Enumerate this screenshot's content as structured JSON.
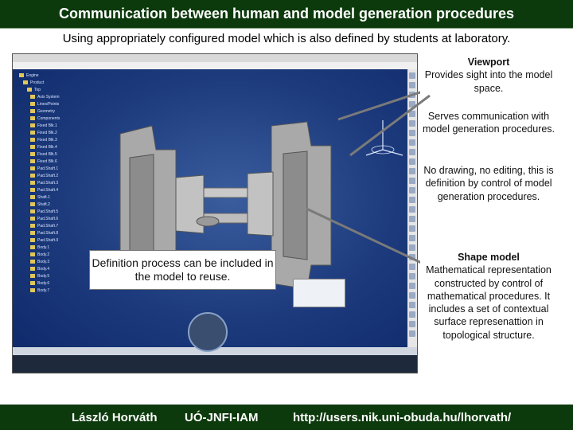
{
  "title": "Communication between human and model generation procedures",
  "subtitle": "Using appropriately configured model which is also defined by students at laboratory.",
  "screenshot": {
    "tree_items": [
      "Engine",
      "Product",
      "Top",
      "Axis System",
      "Lines/Points",
      "Geometry",
      "Components",
      "Fixed Blk.1",
      "Fixed Blk.2",
      "Fixed Blk.3",
      "Fixed Blk.4",
      "Fixed Blk.5",
      "Fixed Blk.6",
      "Pad.Shaft.1",
      "Pad.Shaft.2",
      "Pad.Shaft.3",
      "Pad.Shaft.4",
      "Shaft.1",
      "Shaft.2",
      "Pad.Shaft.5",
      "Pad.Shaft.6",
      "Pad.Shaft.7",
      "Pad.Shaft.8",
      "Pad.Shaft.9",
      "Body.1",
      "Body.2",
      "Body.3",
      "Body.4",
      "Body.5",
      "Body.6",
      "Body.7"
    ]
  },
  "definition_box": "Definition process can be included in the model to reuse.",
  "callouts": {
    "viewport_title": "Viewport",
    "viewport_text": "Provides sight into the model space.",
    "serves_text": "Serves communication with model generation procedures.",
    "no_drawing_text": "No drawing, no editing, this is definition by control of model generation procedures.",
    "shape_title": "Shape model",
    "shape_text": "Mathematical representation constructed by control of mathematical procedures. It includes a set of contextual surface represenattion in topological structure."
  },
  "footer": {
    "author": "László Horváth",
    "institute": "UÓ-JNFI-IAM",
    "url": "http://users.nik.uni-obuda.hu/lhorvath/"
  },
  "colors": {
    "header_bg": "#0d3a0d",
    "viewport_bg": "#1c3a7c",
    "part": "#b9b9b9"
  }
}
